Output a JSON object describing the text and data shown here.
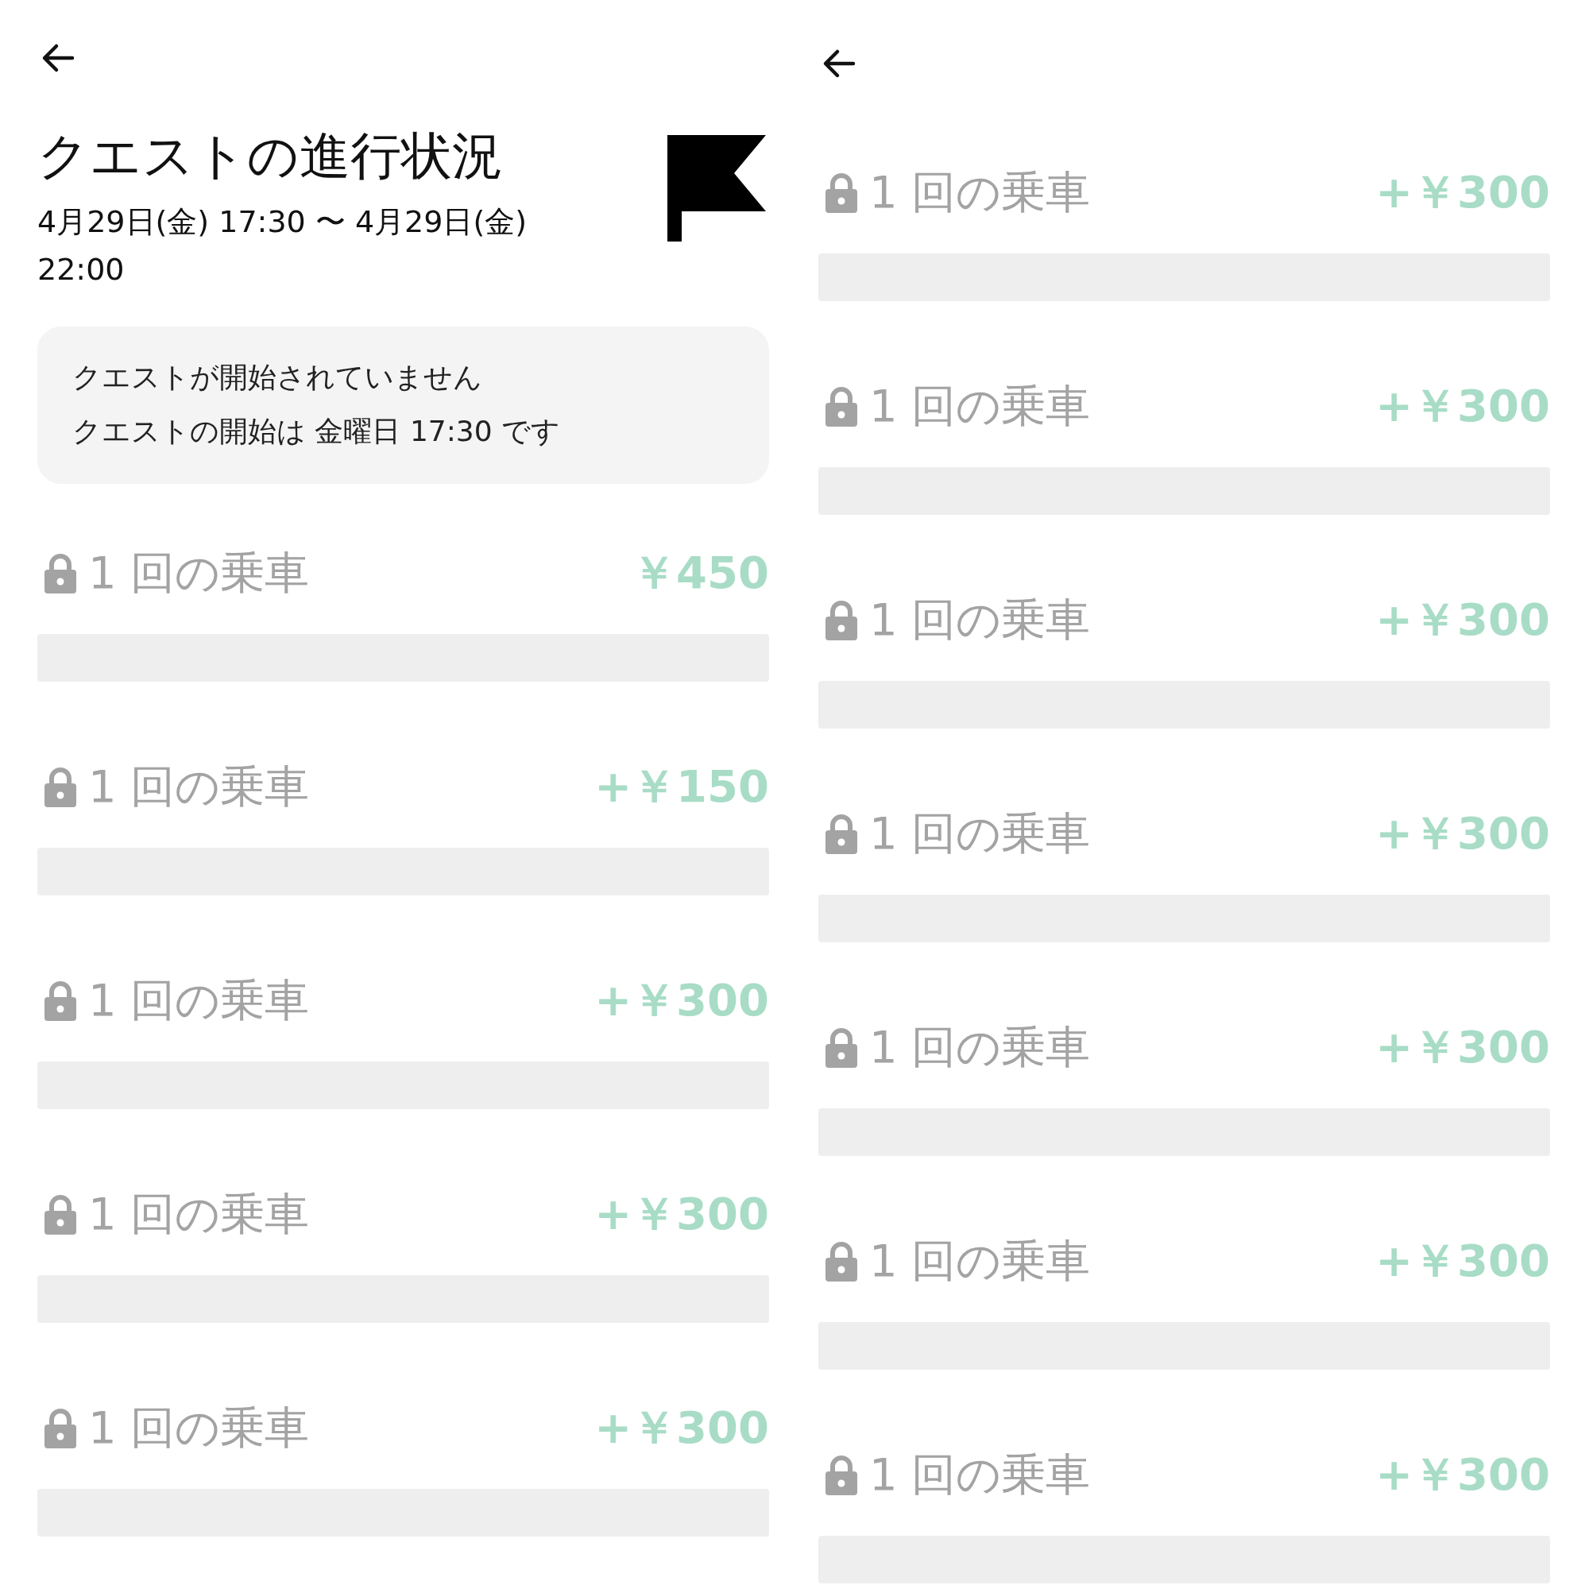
{
  "screens": [
    {
      "header": {
        "title": "クエストの進行状況",
        "period": "4月29日(金) 17:30 〜 4月29日(金) 22:00"
      },
      "notice": {
        "lines": [
          "クエストが開始されていません",
          "クエストの開始は 金曜日 17:30 です"
        ]
      },
      "rides": [
        {
          "label": "1 回の乗車",
          "reward": "￥450",
          "locked": true
        },
        {
          "label": "1 回の乗車",
          "reward": "+￥150",
          "locked": true
        },
        {
          "label": "1 回の乗車",
          "reward": "+￥300",
          "locked": true
        },
        {
          "label": "1 回の乗車",
          "reward": "+￥300",
          "locked": true
        },
        {
          "label": "1 回の乗車",
          "reward": "+￥300",
          "locked": true
        }
      ]
    },
    {
      "rides": [
        {
          "label": "1 回の乗車",
          "reward": "+￥300",
          "locked": true
        },
        {
          "label": "1 回の乗車",
          "reward": "+￥300",
          "locked": true
        },
        {
          "label": "1 回の乗車",
          "reward": "+￥300",
          "locked": true
        },
        {
          "label": "1 回の乗車",
          "reward": "+￥300",
          "locked": true
        },
        {
          "label": "1 回の乗車",
          "reward": "+￥300",
          "locked": true
        },
        {
          "label": "1 回の乗車",
          "reward": "+￥300",
          "locked": true
        },
        {
          "label": "1 回の乗車",
          "reward": "+￥300",
          "locked": true
        }
      ]
    }
  ]
}
